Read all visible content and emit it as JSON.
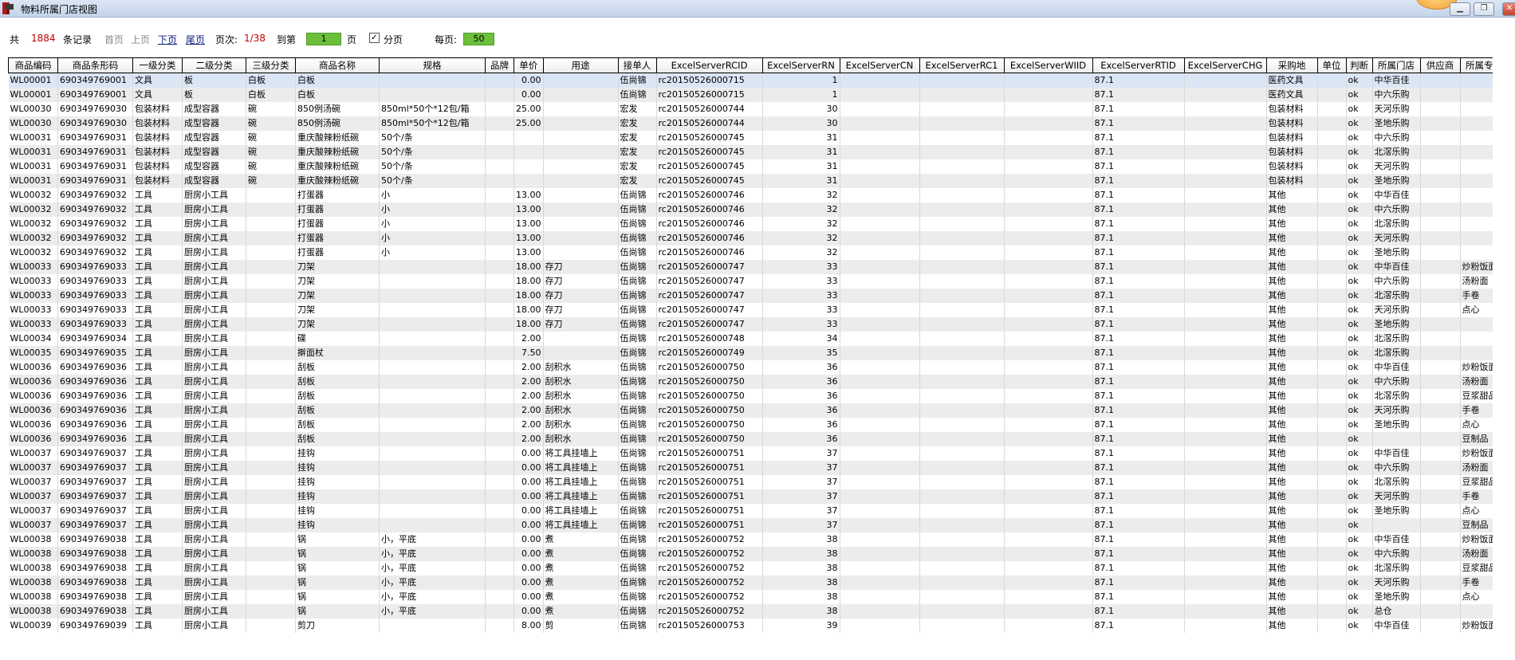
{
  "window": {
    "title": "物料所属门店视图",
    "min": "▁",
    "max": "❐",
    "close": "✕"
  },
  "pager": {
    "total_prefix": "共",
    "total": "1884",
    "total_suffix": "条记录",
    "first": "首页",
    "prev": "上页",
    "next": "下页",
    "last": "尾页",
    "page_label": "页次:",
    "page_value": "1/38",
    "goto_label": "到第",
    "goto_value": "1",
    "goto_suffix": "页",
    "paging_check": "✓",
    "paging_label": "分页",
    "per_page_label": "每页:",
    "per_page_value": "50"
  },
  "columns": [
    "商品编码",
    "商品条形码",
    "一级分类",
    "二级分类",
    "三级分类",
    "商品名称",
    "规格",
    "品牌",
    "单价",
    "用途",
    "接单人",
    "ExcelServerRCID",
    "ExcelServerRN",
    "ExcelServerCN",
    "ExcelServerRC1",
    "ExcelServerWIID",
    "ExcelServerRTID",
    "ExcelServerCHG",
    "采购地",
    "单位",
    "判断",
    "所属门店",
    "供应商",
    "所属专柜"
  ],
  "rows": [
    [
      "WL00001",
      "690349769001",
      "文具",
      "板",
      "白板",
      "白板",
      "",
      "",
      "0.00",
      "",
      "伍尚锦",
      "rc20150526000715",
      "1",
      "",
      "",
      "",
      "87.1",
      "",
      "医药文具",
      "",
      "ok",
      "中华百佳",
      "",
      ""
    ],
    [
      "WL00001",
      "690349769001",
      "文具",
      "板",
      "白板",
      "白板",
      "",
      "",
      "0.00",
      "",
      "伍尚锦",
      "rc20150526000715",
      "1",
      "",
      "",
      "",
      "87.1",
      "",
      "医药文具",
      "",
      "ok",
      "中六乐购",
      "",
      ""
    ],
    [
      "WL00030",
      "690349769030",
      "包装材料",
      "成型容器",
      "碗",
      "850例汤碗",
      "850ml*50个*12包/箱",
      "",
      "25.00",
      "",
      "宏发",
      "rc20150526000744",
      "30",
      "",
      "",
      "",
      "87.1",
      "",
      "包装材料",
      "",
      "ok",
      "天河乐购",
      "",
      ""
    ],
    [
      "WL00030",
      "690349769030",
      "包装材料",
      "成型容器",
      "碗",
      "850例汤碗",
      "850ml*50个*12包/箱",
      "",
      "25.00",
      "",
      "宏发",
      "rc20150526000744",
      "30",
      "",
      "",
      "",
      "87.1",
      "",
      "包装材料",
      "",
      "ok",
      "圣地乐购",
      "",
      ""
    ],
    [
      "WL00031",
      "690349769031",
      "包装材料",
      "成型容器",
      "碗",
      "重庆酸辣粉纸碗",
      "50个/条",
      "",
      "",
      "",
      "宏发",
      "rc20150526000745",
      "31",
      "",
      "",
      "",
      "87.1",
      "",
      "包装材料",
      "",
      "ok",
      "中六乐购",
      "",
      ""
    ],
    [
      "WL00031",
      "690349769031",
      "包装材料",
      "成型容器",
      "碗",
      "重庆酸辣粉纸碗",
      "50个/条",
      "",
      "",
      "",
      "宏发",
      "rc20150526000745",
      "31",
      "",
      "",
      "",
      "87.1",
      "",
      "包装材料",
      "",
      "ok",
      "北滘乐购",
      "",
      ""
    ],
    [
      "WL00031",
      "690349769031",
      "包装材料",
      "成型容器",
      "碗",
      "重庆酸辣粉纸碗",
      "50个/条",
      "",
      "",
      "",
      "宏发",
      "rc20150526000745",
      "31",
      "",
      "",
      "",
      "87.1",
      "",
      "包装材料",
      "",
      "ok",
      "天河乐购",
      "",
      ""
    ],
    [
      "WL00031",
      "690349769031",
      "包装材料",
      "成型容器",
      "碗",
      "重庆酸辣粉纸碗",
      "50个/条",
      "",
      "",
      "",
      "宏发",
      "rc20150526000745",
      "31",
      "",
      "",
      "",
      "87.1",
      "",
      "包装材料",
      "",
      "ok",
      "圣地乐购",
      "",
      ""
    ],
    [
      "WL00032",
      "690349769032",
      "工具",
      "厨房小工具",
      "",
      "打蛋器",
      "小",
      "",
      "13.00",
      "",
      "伍尚锦",
      "rc20150526000746",
      "32",
      "",
      "",
      "",
      "87.1",
      "",
      "其他",
      "",
      "ok",
      "中华百佳",
      "",
      ""
    ],
    [
      "WL00032",
      "690349769032",
      "工具",
      "厨房小工具",
      "",
      "打蛋器",
      "小",
      "",
      "13.00",
      "",
      "伍尚锦",
      "rc20150526000746",
      "32",
      "",
      "",
      "",
      "87.1",
      "",
      "其他",
      "",
      "ok",
      "中六乐购",
      "",
      ""
    ],
    [
      "WL00032",
      "690349769032",
      "工具",
      "厨房小工具",
      "",
      "打蛋器",
      "小",
      "",
      "13.00",
      "",
      "伍尚锦",
      "rc20150526000746",
      "32",
      "",
      "",
      "",
      "87.1",
      "",
      "其他",
      "",
      "ok",
      "北滘乐购",
      "",
      ""
    ],
    [
      "WL00032",
      "690349769032",
      "工具",
      "厨房小工具",
      "",
      "打蛋器",
      "小",
      "",
      "13.00",
      "",
      "伍尚锦",
      "rc20150526000746",
      "32",
      "",
      "",
      "",
      "87.1",
      "",
      "其他",
      "",
      "ok",
      "天河乐购",
      "",
      ""
    ],
    [
      "WL00032",
      "690349769032",
      "工具",
      "厨房小工具",
      "",
      "打蛋器",
      "小",
      "",
      "13.00",
      "",
      "伍尚锦",
      "rc20150526000746",
      "32",
      "",
      "",
      "",
      "87.1",
      "",
      "其他",
      "",
      "ok",
      "圣地乐购",
      "",
      ""
    ],
    [
      "WL00033",
      "690349769033",
      "工具",
      "厨房小工具",
      "",
      "刀架",
      "",
      "",
      "18.00",
      "存刀",
      "伍尚锦",
      "rc20150526000747",
      "33",
      "",
      "",
      "",
      "87.1",
      "",
      "其他",
      "",
      "ok",
      "中华百佳",
      "",
      "炒粉饭面"
    ],
    [
      "WL00033",
      "690349769033",
      "工具",
      "厨房小工具",
      "",
      "刀架",
      "",
      "",
      "18.00",
      "存刀",
      "伍尚锦",
      "rc20150526000747",
      "33",
      "",
      "",
      "",
      "87.1",
      "",
      "其他",
      "",
      "ok",
      "中六乐购",
      "",
      "汤粉面"
    ],
    [
      "WL00033",
      "690349769033",
      "工具",
      "厨房小工具",
      "",
      "刀架",
      "",
      "",
      "18.00",
      "存刀",
      "伍尚锦",
      "rc20150526000747",
      "33",
      "",
      "",
      "",
      "87.1",
      "",
      "其他",
      "",
      "ok",
      "北滘乐购",
      "",
      "手卷"
    ],
    [
      "WL00033",
      "690349769033",
      "工具",
      "厨房小工具",
      "",
      "刀架",
      "",
      "",
      "18.00",
      "存刀",
      "伍尚锦",
      "rc20150526000747",
      "33",
      "",
      "",
      "",
      "87.1",
      "",
      "其他",
      "",
      "ok",
      "天河乐购",
      "",
      "点心"
    ],
    [
      "WL00033",
      "690349769033",
      "工具",
      "厨房小工具",
      "",
      "刀架",
      "",
      "",
      "18.00",
      "存刀",
      "伍尚锦",
      "rc20150526000747",
      "33",
      "",
      "",
      "",
      "87.1",
      "",
      "其他",
      "",
      "ok",
      "圣地乐购",
      "",
      ""
    ],
    [
      "WL00034",
      "690349769034",
      "工具",
      "厨房小工具",
      "",
      "碟",
      "",
      "",
      "2.00",
      "",
      "伍尚锦",
      "rc20150526000748",
      "34",
      "",
      "",
      "",
      "87.1",
      "",
      "其他",
      "",
      "ok",
      "北滘乐购",
      "",
      ""
    ],
    [
      "WL00035",
      "690349769035",
      "工具",
      "厨房小工具",
      "",
      "擀面杖",
      "",
      "",
      "7.50",
      "",
      "伍尚锦",
      "rc20150526000749",
      "35",
      "",
      "",
      "",
      "87.1",
      "",
      "其他",
      "",
      "ok",
      "北滘乐购",
      "",
      ""
    ],
    [
      "WL00036",
      "690349769036",
      "工具",
      "厨房小工具",
      "",
      "刮板",
      "",
      "",
      "2.00",
      "刮积水",
      "伍尚锦",
      "rc20150526000750",
      "36",
      "",
      "",
      "",
      "87.1",
      "",
      "其他",
      "",
      "ok",
      "中华百佳",
      "",
      "炒粉饭面"
    ],
    [
      "WL00036",
      "690349769036",
      "工具",
      "厨房小工具",
      "",
      "刮板",
      "",
      "",
      "2.00",
      "刮积水",
      "伍尚锦",
      "rc20150526000750",
      "36",
      "",
      "",
      "",
      "87.1",
      "",
      "其他",
      "",
      "ok",
      "中六乐购",
      "",
      "汤粉面"
    ],
    [
      "WL00036",
      "690349769036",
      "工具",
      "厨房小工具",
      "",
      "刮板",
      "",
      "",
      "2.00",
      "刮积水",
      "伍尚锦",
      "rc20150526000750",
      "36",
      "",
      "",
      "",
      "87.1",
      "",
      "其他",
      "",
      "ok",
      "北滘乐购",
      "",
      "豆浆甜品"
    ],
    [
      "WL00036",
      "690349769036",
      "工具",
      "厨房小工具",
      "",
      "刮板",
      "",
      "",
      "2.00",
      "刮积水",
      "伍尚锦",
      "rc20150526000750",
      "36",
      "",
      "",
      "",
      "87.1",
      "",
      "其他",
      "",
      "ok",
      "天河乐购",
      "",
      "手卷"
    ],
    [
      "WL00036",
      "690349769036",
      "工具",
      "厨房小工具",
      "",
      "刮板",
      "",
      "",
      "2.00",
      "刮积水",
      "伍尚锦",
      "rc20150526000750",
      "36",
      "",
      "",
      "",
      "87.1",
      "",
      "其他",
      "",
      "ok",
      "圣地乐购",
      "",
      "点心"
    ],
    [
      "WL00036",
      "690349769036",
      "工具",
      "厨房小工具",
      "",
      "刮板",
      "",
      "",
      "2.00",
      "刮积水",
      "伍尚锦",
      "rc20150526000750",
      "36",
      "",
      "",
      "",
      "87.1",
      "",
      "其他",
      "",
      "ok",
      "",
      "",
      "豆制品"
    ],
    [
      "WL00037",
      "690349769037",
      "工具",
      "厨房小工具",
      "",
      "挂钩",
      "",
      "",
      "0.00",
      "将工具挂墙上",
      "伍尚锦",
      "rc20150526000751",
      "37",
      "",
      "",
      "",
      "87.1",
      "",
      "其他",
      "",
      "ok",
      "中华百佳",
      "",
      "炒粉饭面"
    ],
    [
      "WL00037",
      "690349769037",
      "工具",
      "厨房小工具",
      "",
      "挂钩",
      "",
      "",
      "0.00",
      "将工具挂墙上",
      "伍尚锦",
      "rc20150526000751",
      "37",
      "",
      "",
      "",
      "87.1",
      "",
      "其他",
      "",
      "ok",
      "中六乐购",
      "",
      "汤粉面"
    ],
    [
      "WL00037",
      "690349769037",
      "工具",
      "厨房小工具",
      "",
      "挂钩",
      "",
      "",
      "0.00",
      "将工具挂墙上",
      "伍尚锦",
      "rc20150526000751",
      "37",
      "",
      "",
      "",
      "87.1",
      "",
      "其他",
      "",
      "ok",
      "北滘乐购",
      "",
      "豆浆甜品"
    ],
    [
      "WL00037",
      "690349769037",
      "工具",
      "厨房小工具",
      "",
      "挂钩",
      "",
      "",
      "0.00",
      "将工具挂墙上",
      "伍尚锦",
      "rc20150526000751",
      "37",
      "",
      "",
      "",
      "87.1",
      "",
      "其他",
      "",
      "ok",
      "天河乐购",
      "",
      "手卷"
    ],
    [
      "WL00037",
      "690349769037",
      "工具",
      "厨房小工具",
      "",
      "挂钩",
      "",
      "",
      "0.00",
      "将工具挂墙上",
      "伍尚锦",
      "rc20150526000751",
      "37",
      "",
      "",
      "",
      "87.1",
      "",
      "其他",
      "",
      "ok",
      "圣地乐购",
      "",
      "点心"
    ],
    [
      "WL00037",
      "690349769037",
      "工具",
      "厨房小工具",
      "",
      "挂钩",
      "",
      "",
      "0.00",
      "将工具挂墙上",
      "伍尚锦",
      "rc20150526000751",
      "37",
      "",
      "",
      "",
      "87.1",
      "",
      "其他",
      "",
      "ok",
      "",
      "",
      "豆制品"
    ],
    [
      "WL00038",
      "690349769038",
      "工具",
      "厨房小工具",
      "",
      "锅",
      "小，平底",
      "",
      "0.00",
      "煮",
      "伍尚锦",
      "rc20150526000752",
      "38",
      "",
      "",
      "",
      "87.1",
      "",
      "其他",
      "",
      "ok",
      "中华百佳",
      "",
      "炒粉饭面"
    ],
    [
      "WL00038",
      "690349769038",
      "工具",
      "厨房小工具",
      "",
      "锅",
      "小，平底",
      "",
      "0.00",
      "煮",
      "伍尚锦",
      "rc20150526000752",
      "38",
      "",
      "",
      "",
      "87.1",
      "",
      "其他",
      "",
      "ok",
      "中六乐购",
      "",
      "汤粉面"
    ],
    [
      "WL00038",
      "690349769038",
      "工具",
      "厨房小工具",
      "",
      "锅",
      "小，平底",
      "",
      "0.00",
      "煮",
      "伍尚锦",
      "rc20150526000752",
      "38",
      "",
      "",
      "",
      "87.1",
      "",
      "其他",
      "",
      "ok",
      "北滘乐购",
      "",
      "豆浆甜品"
    ],
    [
      "WL00038",
      "690349769038",
      "工具",
      "厨房小工具",
      "",
      "锅",
      "小，平底",
      "",
      "0.00",
      "煮",
      "伍尚锦",
      "rc20150526000752",
      "38",
      "",
      "",
      "",
      "87.1",
      "",
      "其他",
      "",
      "ok",
      "天河乐购",
      "",
      "手卷"
    ],
    [
      "WL00038",
      "690349769038",
      "工具",
      "厨房小工具",
      "",
      "锅",
      "小，平底",
      "",
      "0.00",
      "煮",
      "伍尚锦",
      "rc20150526000752",
      "38",
      "",
      "",
      "",
      "87.1",
      "",
      "其他",
      "",
      "ok",
      "圣地乐购",
      "",
      "点心"
    ],
    [
      "WL00038",
      "690349769038",
      "工具",
      "厨房小工具",
      "",
      "锅",
      "小，平底",
      "",
      "0.00",
      "煮",
      "伍尚锦",
      "rc20150526000752",
      "38",
      "",
      "",
      "",
      "87.1",
      "",
      "其他",
      "",
      "ok",
      "总仓",
      "",
      ""
    ],
    [
      "WL00039",
      "690349769039",
      "工具",
      "厨房小工具",
      "",
      "剪刀",
      "",
      "",
      "8.00",
      "剪",
      "伍尚锦",
      "rc20150526000753",
      "39",
      "",
      "",
      "",
      "87.1",
      "",
      "其他",
      "",
      "ok",
      "中华百佳",
      "",
      "炒粉饭面"
    ]
  ]
}
